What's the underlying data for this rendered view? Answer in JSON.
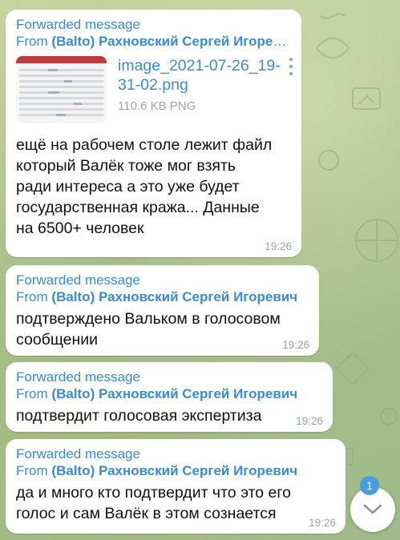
{
  "messages": [
    {
      "forwarded_label": "Forwarded message",
      "from_prefix": "From",
      "from_name": "(Balto) Рахновский Сергей Игоревич",
      "attachment": {
        "file_name": "image_2021-07-26_19-31-02.png",
        "file_size": "110.6 KB PNG",
        "icon": "more-vertical-icon"
      },
      "text": "ещё на рабочем столе лежит файл который Валёк тоже мог взять ради интереса а это уже будет государственная кража... Данные на 6500+ человек",
      "time": "19:26"
    },
    {
      "forwarded_label": "Forwarded message",
      "from_prefix": "From",
      "from_name": "(Balto) Рахновский Сергей Игоревич",
      "text": "подтверждено Вальком в голосовом сообщении",
      "time": "19:26"
    },
    {
      "forwarded_label": "Forwarded message",
      "from_prefix": "From",
      "from_name": "(Balto) Рахновский Сергей Игоревич",
      "text": "подтвердит голосовая экспертиза",
      "time": "19:26"
    },
    {
      "forwarded_label": "Forwarded message",
      "from_prefix": "From",
      "from_name": "(Balto) Рахновский Сергей Игоревич",
      "text": "да и много кто подтвердит что это его голос и сам Валёк в этом сознается",
      "time": "19:26"
    }
  ],
  "scroll_button": {
    "icon": "chevron-down-icon",
    "unread_count": "1"
  },
  "colors": {
    "accent": "#3a8ccf",
    "badge": "#4a9ce0",
    "bubble": "#ffffff",
    "wallpaper": "#b9c99a"
  }
}
